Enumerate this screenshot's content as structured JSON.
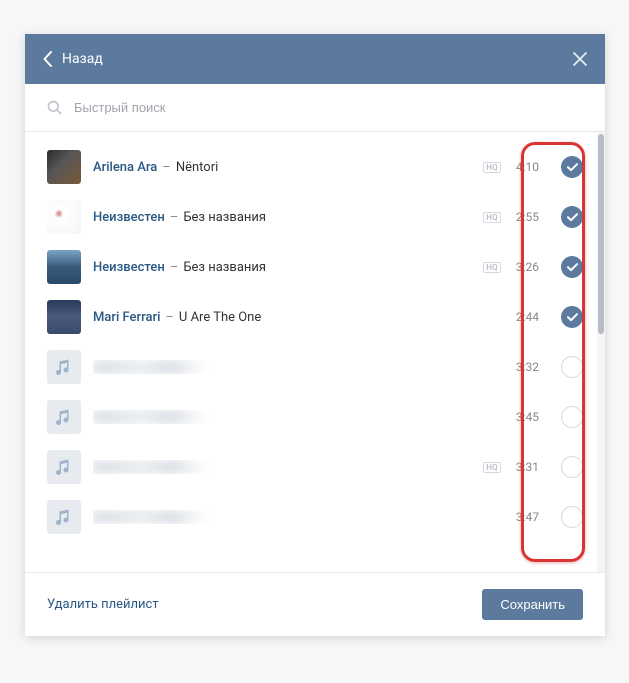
{
  "header": {
    "back_label": "Назад"
  },
  "search": {
    "placeholder": "Быстрый поиск"
  },
  "tracks": [
    {
      "artist": "Arilena Ara",
      "title": "Nëntori",
      "duration": "4:10",
      "hq": true,
      "checked": true,
      "thumb": "thumb1"
    },
    {
      "artist": "Неизвестен",
      "title": "Без названия",
      "duration": "2:55",
      "hq": true,
      "checked": true,
      "thumb": "thumb2"
    },
    {
      "artist": "Неизвестен",
      "title": "Без названия",
      "duration": "3:26",
      "hq": true,
      "checked": true,
      "thumb": "thumb3"
    },
    {
      "artist": "Mari Ferrari",
      "title": "U Are The One",
      "duration": "2:44",
      "hq": false,
      "checked": true,
      "thumb": "thumb4"
    },
    {
      "artist": "",
      "title": "",
      "duration": "3:32",
      "hq": false,
      "checked": false,
      "thumb": "note",
      "blurred": true
    },
    {
      "artist": "",
      "title": "",
      "duration": "3:45",
      "hq": false,
      "checked": false,
      "thumb": "note",
      "blurred": true
    },
    {
      "artist": "",
      "title": "",
      "duration": "3:31",
      "hq": true,
      "checked": false,
      "thumb": "note",
      "blurred": true
    },
    {
      "artist": "",
      "title": "",
      "duration": "3:47",
      "hq": false,
      "checked": false,
      "thumb": "note",
      "blurred": true
    }
  ],
  "footer": {
    "delete_label": "Удалить плейлист",
    "save_label": "Сохранить"
  },
  "badges": {
    "hq": "HQ"
  }
}
